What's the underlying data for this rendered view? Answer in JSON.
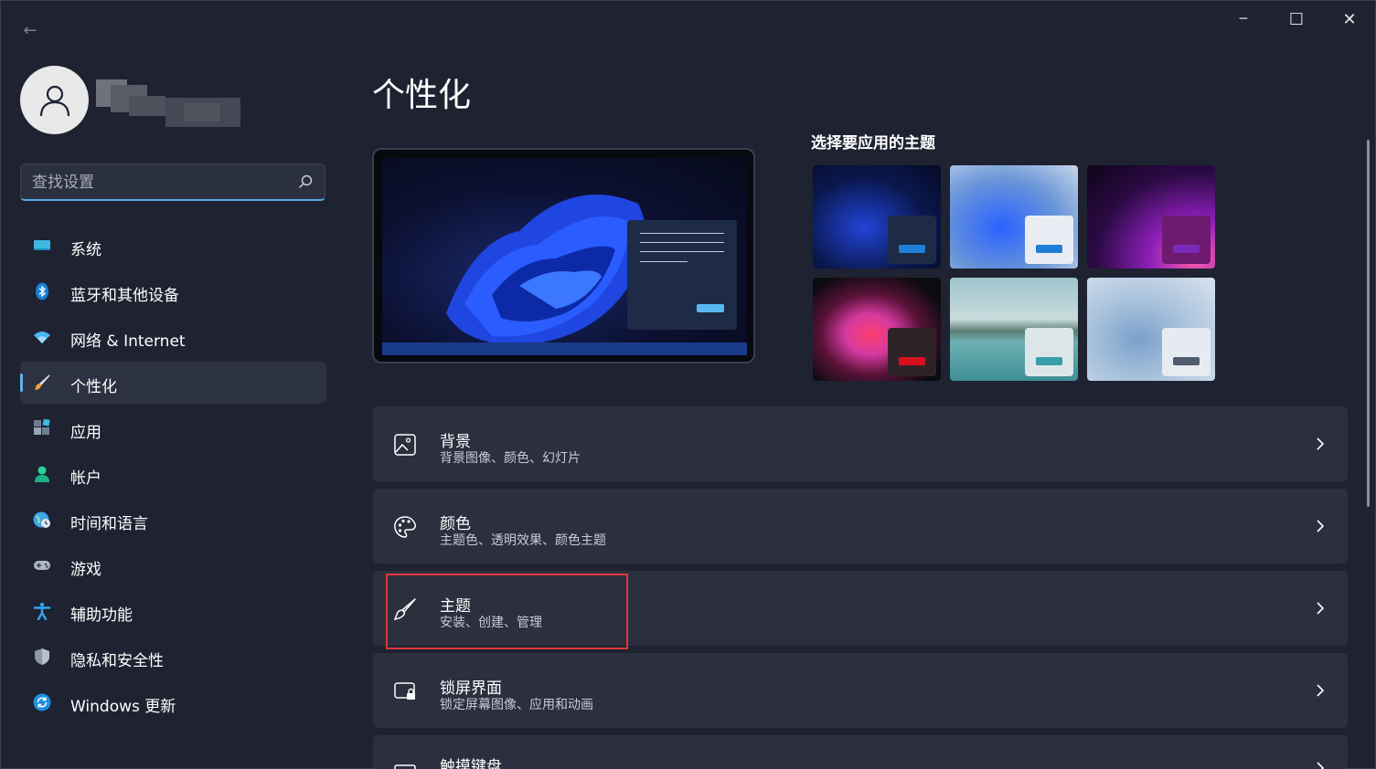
{
  "window": {
    "back_symbol": "←",
    "minimize_symbol": "─",
    "maximize_symbol": "☐",
    "close_symbol": "✕"
  },
  "search": {
    "placeholder": "查找设置"
  },
  "sidebar": {
    "items": [
      {
        "label": "系统",
        "icon": "system-icon"
      },
      {
        "label": "蓝牙和其他设备",
        "icon": "bluetooth-icon"
      },
      {
        "label": "网络 & Internet",
        "icon": "wifi-icon"
      },
      {
        "label": "个性化",
        "icon": "brush-icon",
        "active": true
      },
      {
        "label": "应用",
        "icon": "apps-icon"
      },
      {
        "label": "帐户",
        "icon": "account-icon"
      },
      {
        "label": "时间和语言",
        "icon": "globe-clock-icon"
      },
      {
        "label": "游戏",
        "icon": "gamepad-icon"
      },
      {
        "label": "辅助功能",
        "icon": "accessibility-icon"
      },
      {
        "label": "隐私和安全性",
        "icon": "shield-icon"
      },
      {
        "label": "Windows 更新",
        "icon": "update-icon"
      }
    ]
  },
  "main": {
    "title": "个性化",
    "themes_label": "选择要应用的主题",
    "cards": [
      {
        "title": "背景",
        "subtitle": "背景图像、颜色、幻灯片",
        "icon": "image-icon"
      },
      {
        "title": "颜色",
        "subtitle": "主题色、透明效果、颜色主题",
        "icon": "palette-icon"
      },
      {
        "title": "主题",
        "subtitle": "安装、创建、管理",
        "icon": "brush-icon"
      },
      {
        "title": "锁屏界面",
        "subtitle": "锁定屏幕图像、应用和动画",
        "icon": "lock-screen-icon"
      },
      {
        "title": "触摸键盘",
        "subtitle": "",
        "icon": "keyboard-icon"
      }
    ]
  },
  "colors": {
    "accent": "#5fb2f2",
    "highlight": "#e0363a",
    "background": "#1e2231",
    "card": "#2b2f3e"
  }
}
